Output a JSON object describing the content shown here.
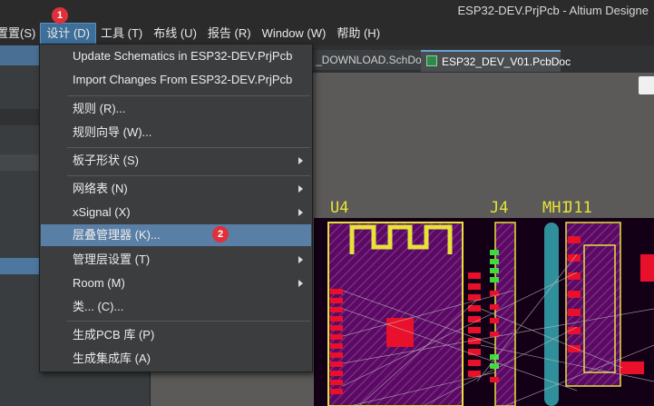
{
  "window": {
    "title": "ESP32-DEV.PrjPcb - Altium Designe"
  },
  "menubar": {
    "items": [
      {
        "label": "置置(S)"
      },
      {
        "label": "设计 (D)"
      },
      {
        "label": "工具 (T)"
      },
      {
        "label": "布线 (U)"
      },
      {
        "label": "报告 (R)"
      },
      {
        "label": "Window (W)"
      },
      {
        "label": "帮助 (H)"
      }
    ]
  },
  "tabs": [
    {
      "label": "_DOWNLOAD.SchDoc"
    },
    {
      "label": "ESP32_DEV_V01.PcbDoc"
    }
  ],
  "design_menu": {
    "items": [
      {
        "label": "Update Schematics in ESP32-DEV.PrjPcb",
        "submenu": false
      },
      {
        "label": "Import Changes From ESP32-DEV.PrjPcb",
        "submenu": false
      },
      {
        "label": "规则 (R)...",
        "submenu": false
      },
      {
        "label": "规则向导 (W)...",
        "submenu": false
      },
      {
        "label": "板子形状 (S)",
        "submenu": true
      },
      {
        "label": "网络表 (N)",
        "submenu": true
      },
      {
        "label": "xSignal (X)",
        "submenu": true
      },
      {
        "label": "层叠管理器 (K)...",
        "submenu": false,
        "highlighted": true
      },
      {
        "label": "管理层设置 (T)",
        "submenu": true
      },
      {
        "label": "Room (M)",
        "submenu": true
      },
      {
        "label": "类... (C)...",
        "submenu": false
      },
      {
        "label": "生成PCB 库 (P)",
        "submenu": false
      },
      {
        "label": "生成集成库 (A)",
        "submenu": false
      }
    ]
  },
  "annotations": [
    {
      "label": "1"
    },
    {
      "label": "2"
    }
  ],
  "pcb": {
    "designators": [
      "U4",
      "J4",
      "MH1",
      "J11"
    ]
  },
  "colors": {
    "highlight": "#5a7fa6",
    "badge": "#e0303a",
    "pad_red": "#e8102a",
    "silk_yellow": "#e6e23a",
    "net_green": "#3ddc3d",
    "board_purple": "#5a0a62"
  }
}
